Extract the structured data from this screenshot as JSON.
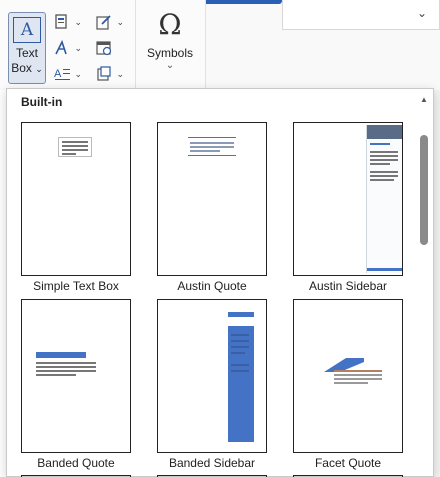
{
  "ribbon": {
    "text_box_label": "Text",
    "text_box_label2": "Box",
    "text_box_chevron": "⌄",
    "text_box_icon_glyph": "A",
    "symbols_glyph": "Ω",
    "symbols_label": "Symbols",
    "symbols_chevron": "⌄",
    "small_chevron": "⌄",
    "right_chevron": "⌄"
  },
  "gallery": {
    "section_header": "Built-in",
    "items": [
      {
        "caption": "Simple Text Box"
      },
      {
        "caption": "Austin Quote"
      },
      {
        "caption": "Austin Sidebar"
      },
      {
        "caption": "Banded Quote"
      },
      {
        "caption": "Banded Sidebar"
      },
      {
        "caption": "Facet Quote"
      }
    ]
  },
  "colors": {
    "accent": "#2a5fb5",
    "band_blue": "#4472c4",
    "scroll_thumb": "#8a8a8a"
  }
}
